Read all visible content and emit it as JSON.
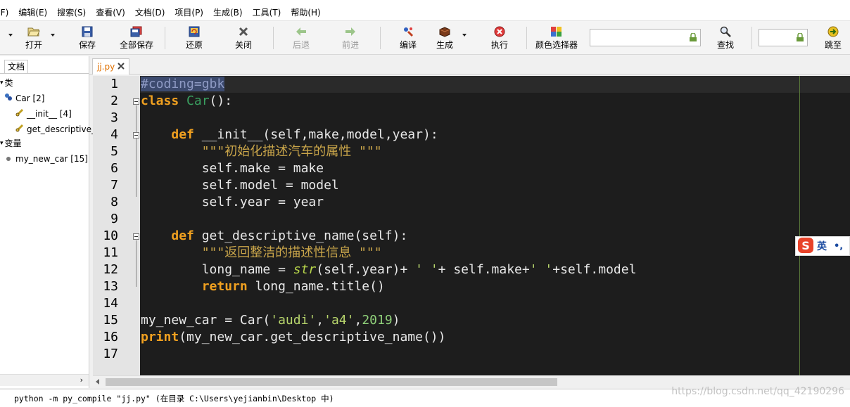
{
  "menu": {
    "items": [
      "(F)",
      "编辑(E)",
      "搜索(S)",
      "查看(V)",
      "文档(D)",
      "项目(P)",
      "生成(B)",
      "工具(T)",
      "帮助(H)"
    ]
  },
  "toolbar": {
    "open": "打开",
    "save": "保存",
    "save_all": "全部保存",
    "revert": "还原",
    "close": "关闭",
    "back": "后退",
    "forward": "前进",
    "compile": "编译",
    "build": "生成",
    "execute": "执行",
    "color_picker": "颜色选择器",
    "search": "查找",
    "goto": "跳至",
    "search_value": "",
    "goto_value": ""
  },
  "sidebar": {
    "tab_label": "文档",
    "sections": {
      "classes": "类",
      "variables": "变量"
    },
    "items": {
      "car": "Car [2]",
      "init": "__init__ [4]",
      "get_desc": "get_descriptive_",
      "my_new_car": "my_new_car [15]"
    }
  },
  "editor": {
    "file_tab": "jj.py",
    "line_numbers": [
      "1",
      "2",
      "3",
      "4",
      "5",
      "6",
      "7",
      "8",
      "9",
      "10",
      "11",
      "12",
      "13",
      "14",
      "15",
      "16",
      "17"
    ]
  },
  "ime": {
    "label": "英",
    "punct": "•,"
  },
  "status": {
    "message": "python -m py_compile \"jj.py\" (在目录 C:\\Users\\yejianbin\\Desktop 中)",
    "watermark": "https://blog.csdn.net/qq_42190296"
  },
  "colors": {
    "editor_bg": "#1d1d1d",
    "keyword": "#f0a020",
    "class_name": "#3aa060",
    "string": "#b7d56c",
    "docstring": "#c9a54a",
    "comment": "#808080"
  }
}
